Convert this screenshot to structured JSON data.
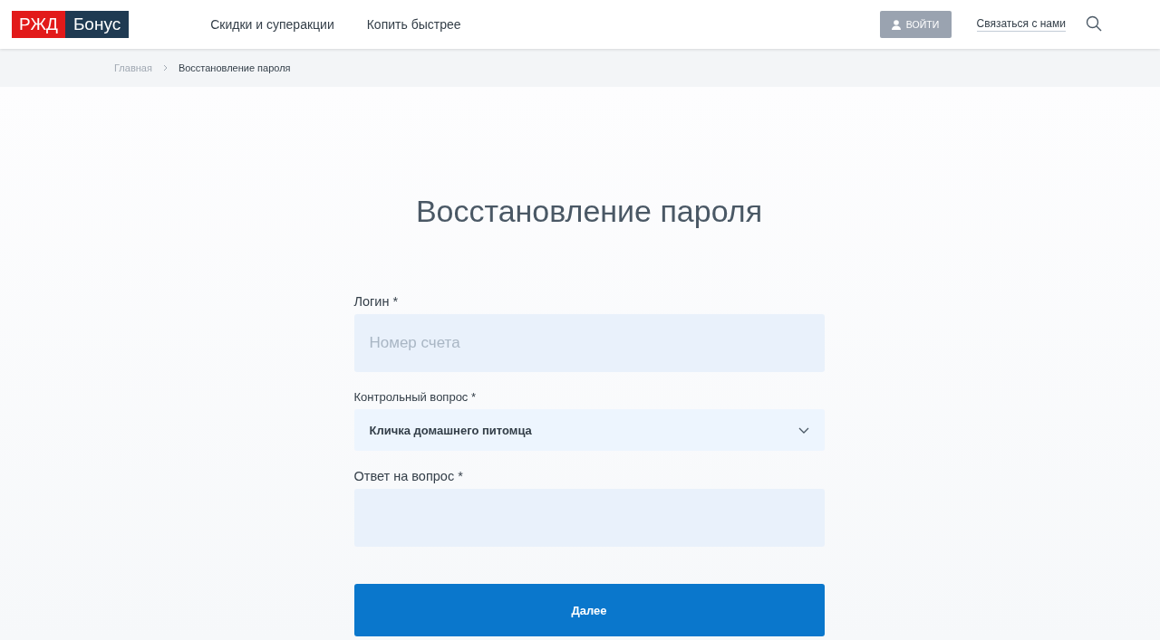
{
  "logo": {
    "part_1": "РЖД",
    "part_2": "Бонус"
  },
  "nav": [
    "Скидки и суперакции",
    "Копить быстрее"
  ],
  "login_button": "ВОЙТИ",
  "contact_link": "Связаться с нами",
  "breadcrumbs": [
    {
      "label": "Главная",
      "current": false
    },
    {
      "label": "Восстановление пароля",
      "current": true
    }
  ],
  "title": "Восстановление пароля",
  "fields": [
    {
      "kind": "text",
      "label": "Логин *",
      "placeholder": "Номер счета"
    },
    {
      "kind": "select",
      "label": "Контрольный вопрос *",
      "value": "Кличка домашнего питомца"
    },
    {
      "kind": "text",
      "label": "Ответ на вопрос *"
    }
  ],
  "submit": "Далее"
}
